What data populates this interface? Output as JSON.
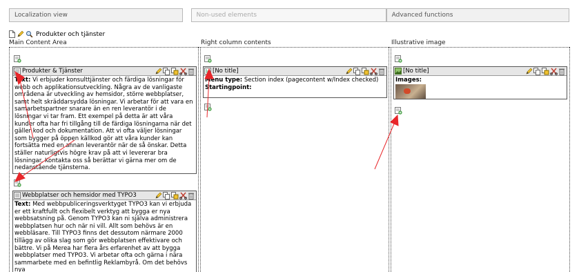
{
  "tabs": [
    "Localization view",
    "Non-used elements",
    "Advanced functions"
  ],
  "page": {
    "title": "Produkter och tjänster"
  },
  "columns": {
    "main": "Main Content Area",
    "right": "Right column contents",
    "image": "Illustrative image"
  },
  "elements": {
    "ce1": {
      "title": "Produkter & Tjänster",
      "label": "Text:",
      "text": "Vi erbjuder konsulttjänster och färdiga lösningar för webb och applikationsutveckling. Några av de vanligaste områdena är utveckling av hemsidor, större webbplatser, samt helt skräddarsydda lösningar. Vi arbetar för att vara en samarbetspartner snarare än en ren leverantör i de lösningar vi tar fram. Ett exempel på detta är att våra kunder ofta har fri tillgång till de färdiga lösningarna när det gäller kod och dokumentation. Att vi ofta väljer lösningar som bygger på öppen källkod gör att våra kunder kan fortsätta med en annan leverantör när de så önskar. Detta ställer naturligtvis högre krav på att vi levererar bra lösningar. Kontakta oss så berättar vi gärna mer om de nedanstående tjänsterna."
    },
    "ce2": {
      "title": "Webbplatser och hemsidor med TYPO3",
      "label": "Text:",
      "text": "Med webbpubliceringsverktyget TYPO3 kan vi erbjuda er ett kraftfullt och flexibelt verktyg att bygga er nya webbsatsning på. Genom TYPO3 kan ni själva administrera webbplatsen hur och när ni vill. Allt som behövs är en webbläsare. Till TYPO3 finns det dessutom närmare 2000 tillägg av olika slag som gör webbplatsen effektivare och bättre. Vi på Merea har flera års erfarenhet av att bygga webbplatser med TYPO3. Vi arbetar ofta och gärna i nära sammarbete med en befintlig Reklambyrå. Om det behövs nya"
    },
    "ce3": {
      "title": "[No title]",
      "menu_label": "Menu type:",
      "menu_value": "Section index (pagecontent w/Index checked)",
      "start_label": "Startingpoint:"
    },
    "ce4": {
      "title": "[No title]",
      "images_label": "Images:"
    }
  },
  "colors": {
    "arrow": "#e8262a",
    "tab_bg": "#f1f1f1",
    "ce_head": "#e6e6e6"
  },
  "icons": [
    "new-record-icon",
    "edit-icon",
    "copy-icon",
    "move-icon",
    "cut-icon",
    "delete-icon",
    "page-icon",
    "search-icon",
    "text-element-icon",
    "image-element-icon"
  ]
}
